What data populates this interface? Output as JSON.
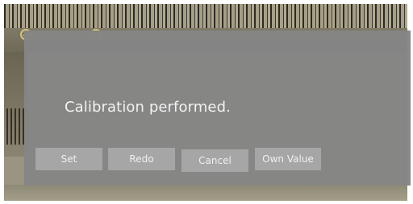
{
  "dialog": {
    "message": "Calibration performed.",
    "buttons": {
      "set": "Set",
      "redo": "Redo",
      "cancel": "Cancel",
      "own_value": "Own Value"
    }
  },
  "colors": {
    "dialog_background": "#858585",
    "button_background": "#a6a6a6",
    "text": "#f2f2f2",
    "marker": "#d6c47a"
  },
  "icons": [
    "calibration-marker-icon"
  ]
}
